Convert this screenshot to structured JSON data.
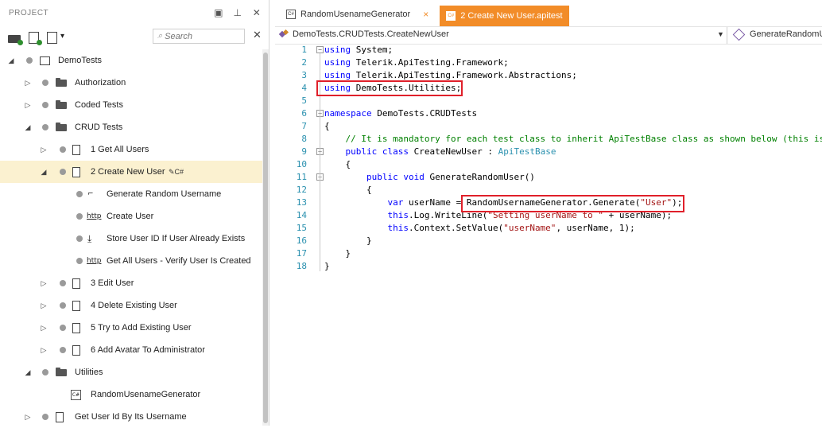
{
  "panel": {
    "title": "PROJECT",
    "header_icons": [
      "pin-window-icon",
      "pin-icon",
      "close-icon"
    ],
    "toolbar_icons": [
      "add-folder-icon",
      "add-test-icon",
      "add-step-icon"
    ],
    "search_placeholder": "Search"
  },
  "tree": [
    {
      "label": "DemoTests",
      "kind": "project",
      "expanded": true
    },
    {
      "label": "Authorization",
      "kind": "folder",
      "expanded": false
    },
    {
      "label": "Coded Tests",
      "kind": "folder",
      "expanded": false
    },
    {
      "label": "CRUD Tests",
      "kind": "folder",
      "expanded": true
    },
    {
      "label": "1 Get All Users",
      "kind": "test",
      "expanded": false
    },
    {
      "label": "2 Create New User",
      "kind": "test",
      "expanded": true,
      "selected": true
    },
    {
      "label": "Generate Random Username",
      "kind": "coded-step"
    },
    {
      "label": "Create User",
      "kind": "http-step"
    },
    {
      "label": "Store User ID If User Already Exists",
      "kind": "condition-step"
    },
    {
      "label": "Get All Users - Verify User Is Created",
      "kind": "http-step"
    },
    {
      "label": "3 Edit User",
      "kind": "test",
      "expanded": false
    },
    {
      "label": "4 Delete Existing User",
      "kind": "test",
      "expanded": false
    },
    {
      "label": "5 Try to Add Existing User",
      "kind": "test",
      "expanded": false
    },
    {
      "label": "6 Add Avatar To Administrator",
      "kind": "test",
      "expanded": false
    },
    {
      "label": "Utilities",
      "kind": "folder",
      "expanded": true
    },
    {
      "label": "RandomUsenameGenerator",
      "kind": "cs-file"
    },
    {
      "label": "Get User Id By Its Username",
      "kind": "test",
      "expanded": false
    }
  ],
  "tabs": [
    {
      "label": "RandomUsenameGenerator",
      "active": false,
      "close": "×"
    },
    {
      "label": "2 Create New User.apitest",
      "active": true
    }
  ],
  "nav": {
    "left": "DemoTests.CRUDTests.CreateNewUser",
    "right": "GenerateRandomU"
  },
  "code_lines": [
    {
      "n": "1",
      "text": "using System;"
    },
    {
      "n": "2",
      "text": "using Telerik.ApiTesting.Framework;"
    },
    {
      "n": "3",
      "text": "using Telerik.ApiTesting.Framework.Abstractions;"
    },
    {
      "n": "4",
      "text": "using DemoTests.Utilities;"
    },
    {
      "n": "5",
      "text": ""
    },
    {
      "n": "6",
      "text": "namespace DemoTests.CRUDTests"
    },
    {
      "n": "7",
      "text": "{"
    },
    {
      "n": "8",
      "text": "    // It is mandatory for each test class to inherit ApiTestBase class as shown below (this is"
    },
    {
      "n": "9",
      "text": "    public class CreateNewUser : ApiTestBase"
    },
    {
      "n": "10",
      "text": "    {"
    },
    {
      "n": "11",
      "text": "        public void GenerateRandomUser()"
    },
    {
      "n": "12",
      "text": "        {"
    },
    {
      "n": "13",
      "text": "            var userName = RandomUsernameGenerator.Generate(\"User\");"
    },
    {
      "n": "14",
      "text": "            this.Log.WriteLine(\"Setting userName to \" + userName);"
    },
    {
      "n": "15",
      "text": "            this.Context.SetValue(\"userName\", userName, 1);"
    },
    {
      "n": "16",
      "text": "        }"
    },
    {
      "n": "17",
      "text": "    }"
    },
    {
      "n": "18",
      "text": "}"
    }
  ],
  "colors": {
    "accent": "#f28c28",
    "highlight_box": "#e0202a",
    "keyword": "#0000ff",
    "comment": "#008000",
    "string": "#a31515",
    "type": "#2b91af",
    "selected_row": "#fbf1d0"
  }
}
